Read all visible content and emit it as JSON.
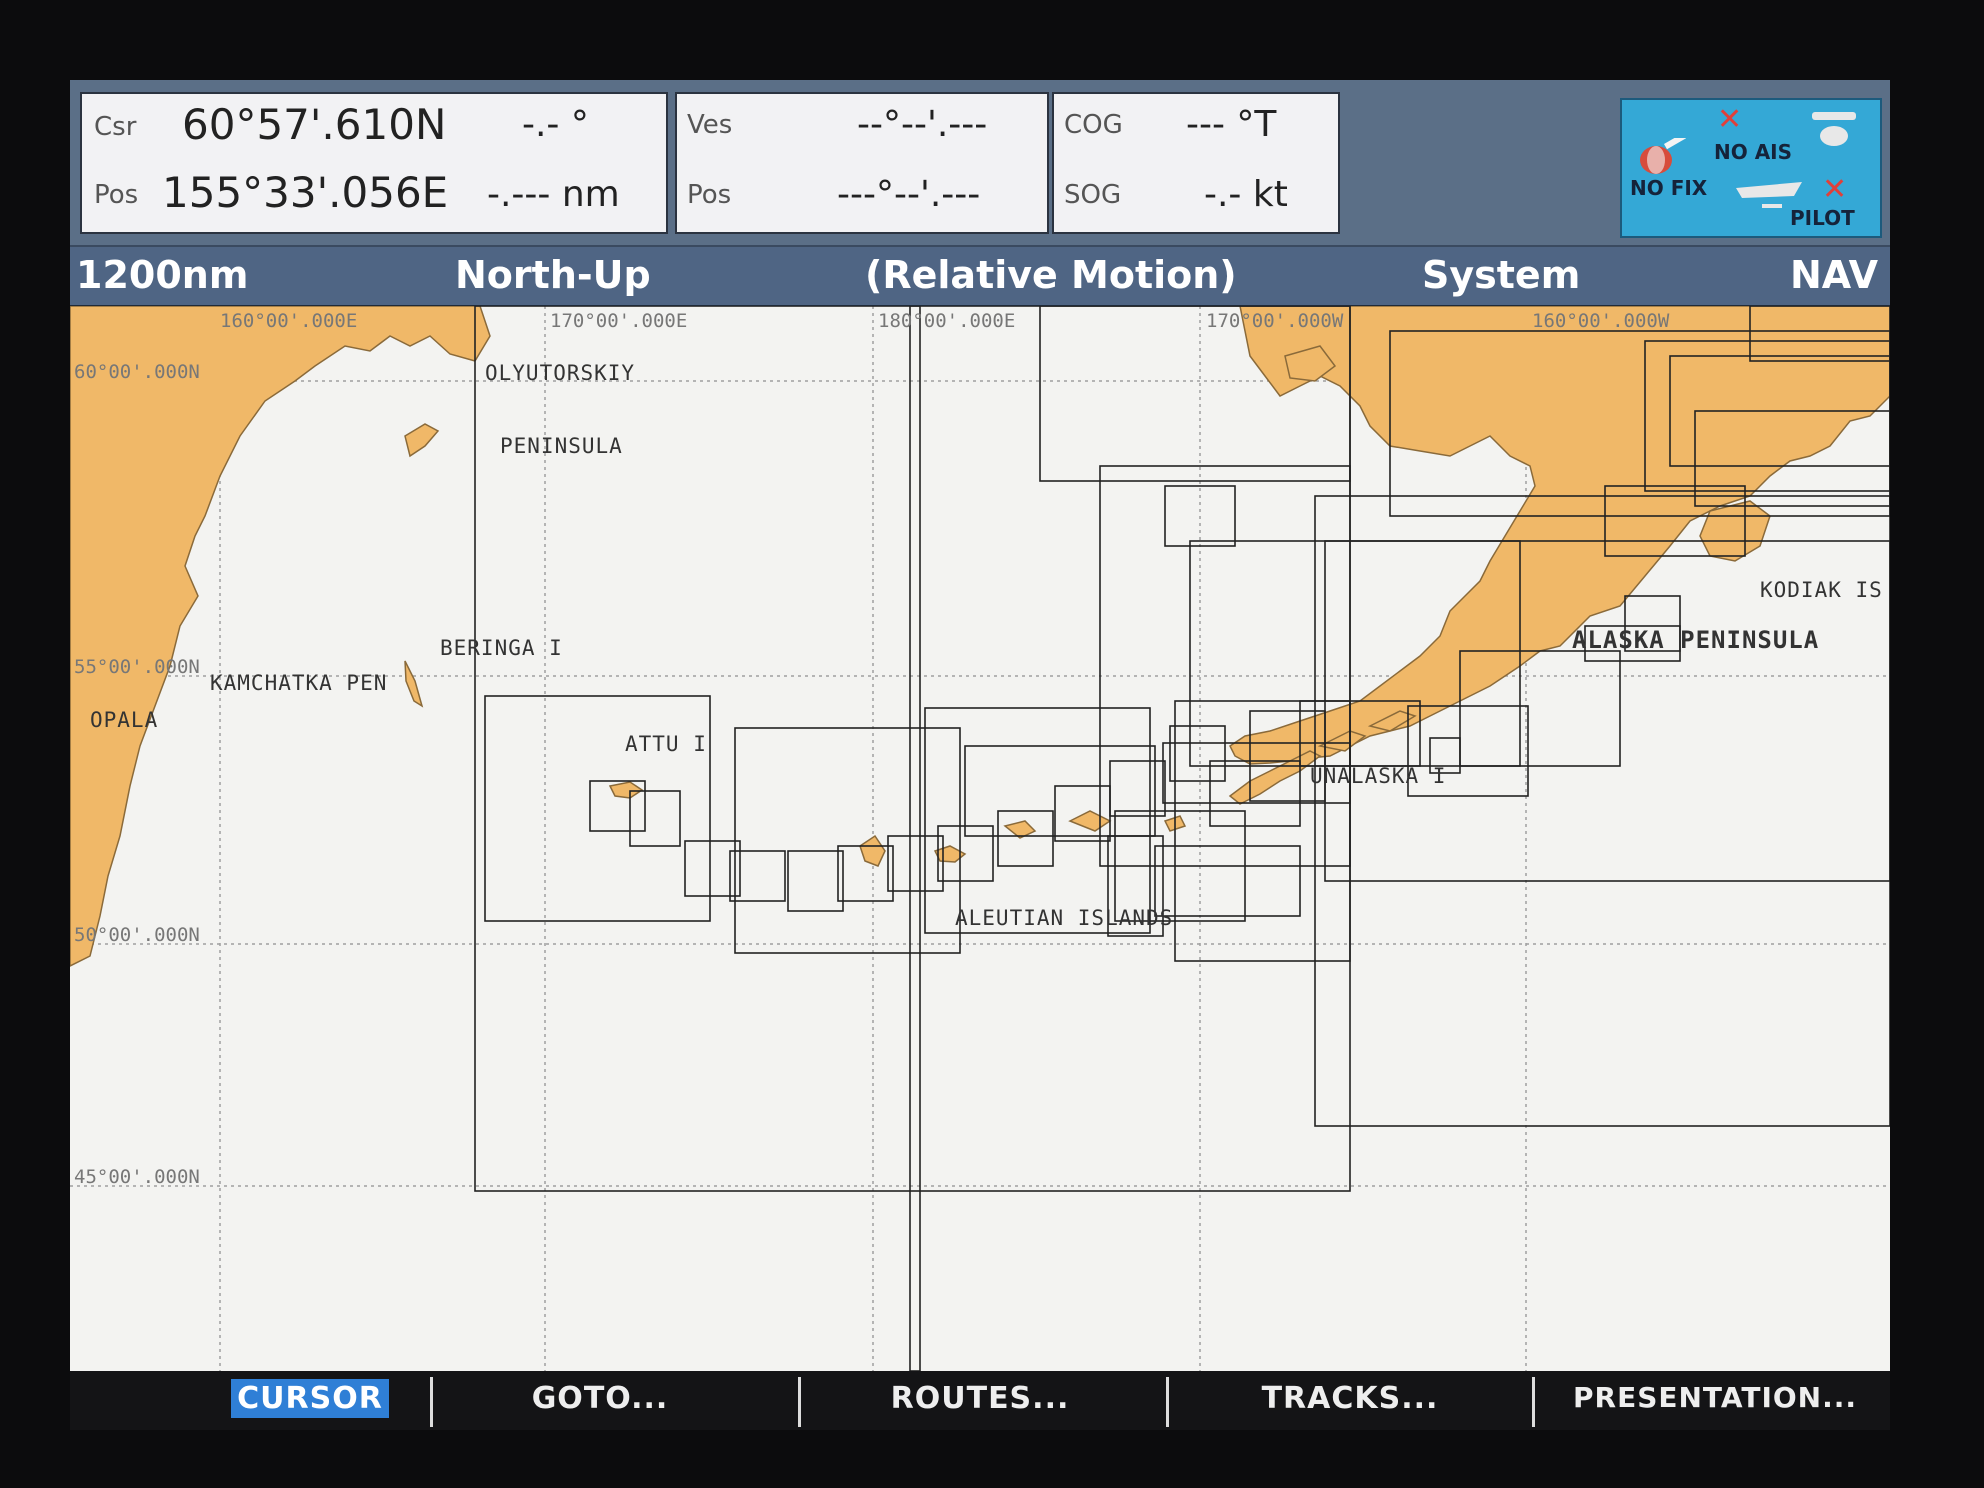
{
  "cursor_panel": {
    "csr_label": "Csr",
    "lat": "60°57'.610N",
    "bearing": "-.- °",
    "pos_label": "Pos",
    "lon": "155°33'.056E",
    "range": "-.--- nm"
  },
  "vessel_panel": {
    "ves_label": "Ves",
    "lat": "--°--'.---",
    "pos_label": "Pos",
    "lon": "---°--'.---"
  },
  "cog_sog_panel": {
    "cog_label": "COG",
    "cog_value": "--- °T",
    "sog_label": "SOG",
    "sog_value": "-.- kt"
  },
  "status_icons": {
    "no_ais": "NO AIS",
    "no_fix": "NO FIX",
    "pilot": "PILOT"
  },
  "status_bar": {
    "range": "1200nm",
    "orientation": "North-Up",
    "motion": "(Relative Motion)",
    "mode": "System",
    "nav": "NAV"
  },
  "chart": {
    "lon_labels": [
      "160°00'.000E",
      "170°00'.000E",
      "180°00'.000E",
      "170°00'.000W",
      "160°00'.000W"
    ],
    "lat_labels": [
      "60°00'.000N",
      "55°00'.000N",
      "50°00'.000N",
      "45°00'.000N"
    ],
    "places": {
      "olyutorskiy": "OLYUTORSKIY",
      "peninsula": "PENINSULA",
      "beringa": "BERINGA I",
      "kamchatka": "KAMCHATKA PEN",
      "opala": "OPALA",
      "attu": "ATTU I",
      "aleutian": "ALEUTIAN ISLANDS",
      "unalaska": "UNALASKA I",
      "alaska_pen": "ALASKA PENINSULA",
      "kodiak": "KODIAK IS"
    },
    "colors": {
      "land": "#f0b868",
      "sea": "#f3f3f1",
      "grid": "#9a9a9a"
    }
  },
  "softkeys": {
    "cursor": "CURSOR",
    "goto": "GOTO...",
    "routes": "ROUTES...",
    "tracks": "TRACKS...",
    "presentation": "PRESENTATION..."
  }
}
